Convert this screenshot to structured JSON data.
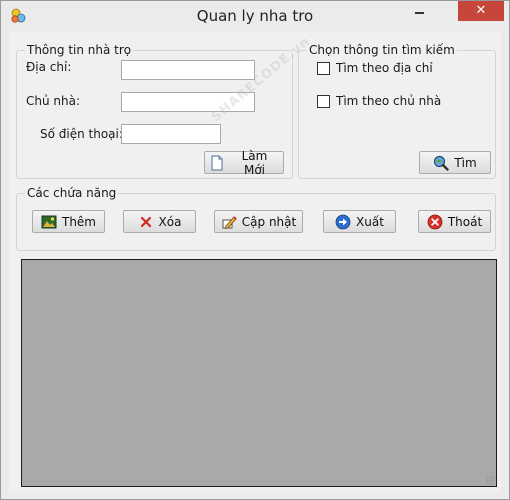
{
  "window": {
    "title": "Quan ly nha tro",
    "minimize_label": "",
    "close_label": "✕"
  },
  "info_group": {
    "title": "Thông tin nhà trọ",
    "address_label": "Địa chỉ:",
    "owner_label": "Chủ nhà:",
    "phone_label": "Số điện thoại:",
    "address_value": "",
    "owner_value": "",
    "phone_value": "",
    "refresh_button": "Làm Mới"
  },
  "search_group": {
    "title": "Chọn thông tin tìm kiếm",
    "by_address": "Tìm theo địa chỉ",
    "by_owner": "Tìm theo chủ nhà",
    "search_button": "Tìm"
  },
  "functions_group": {
    "title": "Các chứa năng",
    "add_button": "Thêm",
    "delete_button": "Xóa",
    "update_button": "Cập nhật",
    "export_button": "Xuất",
    "exit_button": "Thoát"
  },
  "colors": {
    "close_button": "#c7463c",
    "grid_background": "#a9a9a9",
    "window_background": "#f0f0f0"
  },
  "icons": {
    "app": "app-icon",
    "refresh": "document-icon",
    "search": "magnifier-globe-icon",
    "add": "add-record-icon",
    "delete": "red-x-icon",
    "update": "edit-pencil-icon",
    "export": "blue-arrow-icon",
    "exit": "red-circle-x-icon"
  },
  "watermark": "SHARECODE.vn"
}
